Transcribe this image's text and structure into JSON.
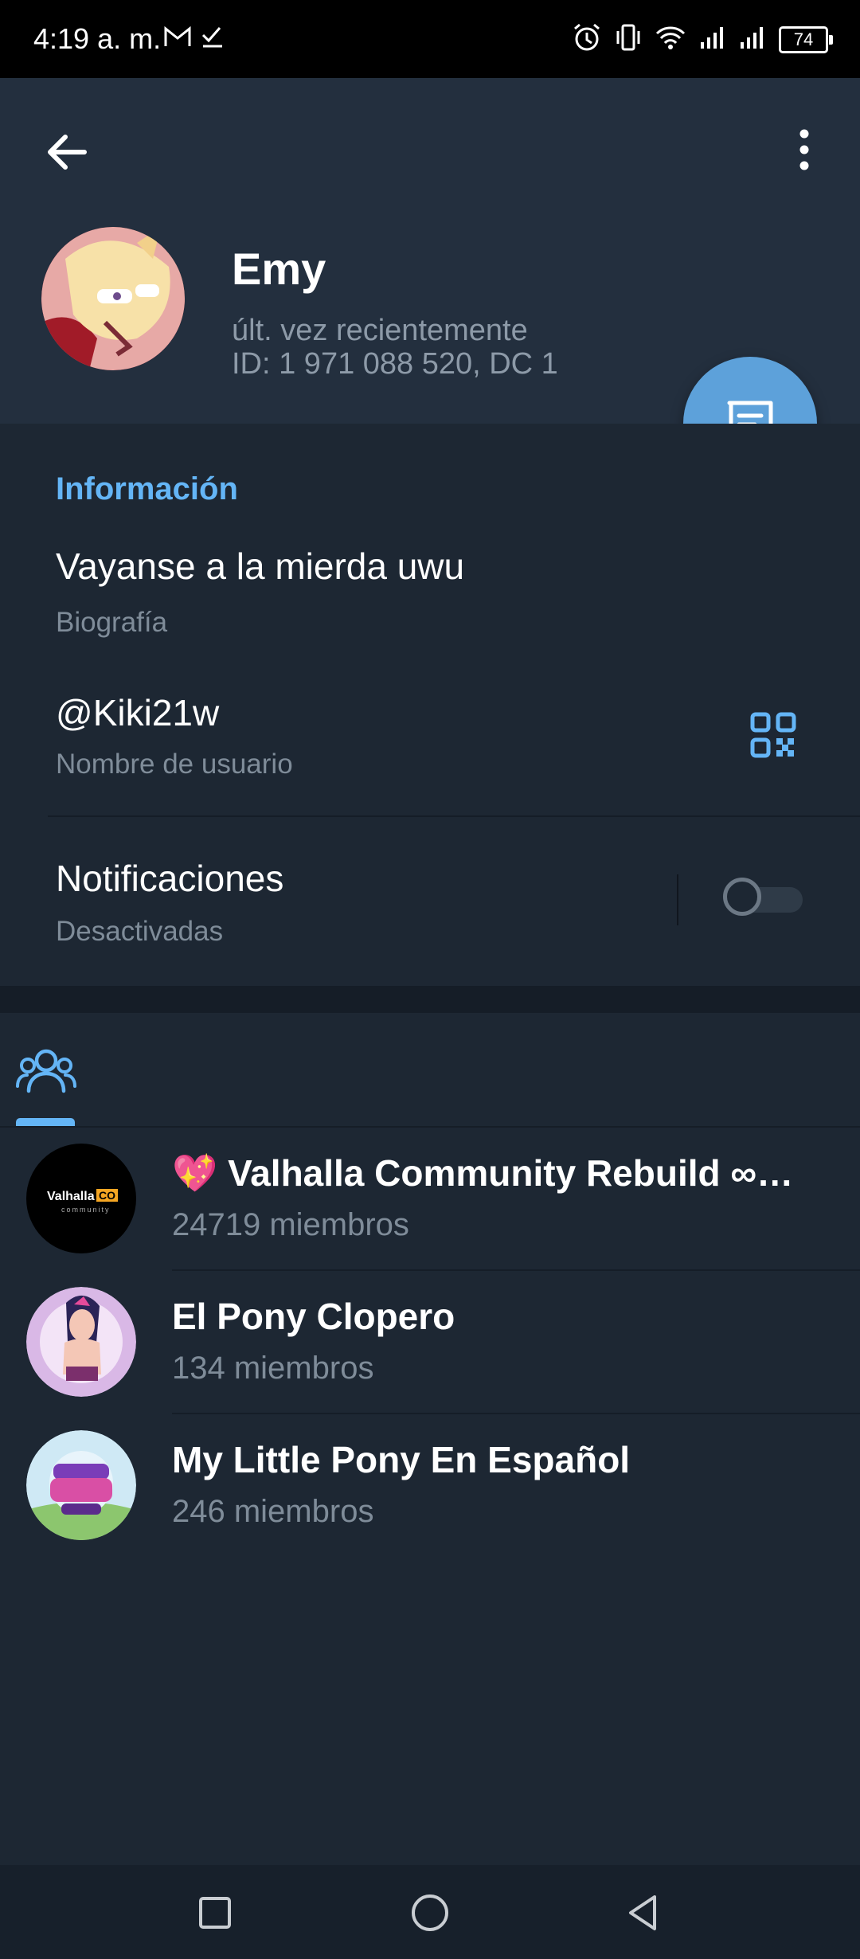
{
  "status_bar": {
    "time": "4:19 a. m.",
    "battery": "74"
  },
  "profile": {
    "name": "Emy",
    "last_seen": "últ. vez recientemente",
    "id_line": "ID: 1 971 088 520, DC 1"
  },
  "info": {
    "section_title": "Información",
    "bio_value": "Vayanse a la mierda uwu",
    "bio_label": "Biografía",
    "username_value": "@Kiki21w",
    "username_label": "Nombre de usuario",
    "notifications_label": "Notificaciones",
    "notifications_value": "Desactivadas",
    "notifications_enabled": false
  },
  "groups": [
    {
      "emoji": "💖",
      "title": "Valhalla Community Rebuild ∞…",
      "members": "24719 miembros",
      "avatar_text": "Valhalla",
      "avatar_badge": "CO",
      "avatar_small": "community"
    },
    {
      "title": "El Pony Clopero",
      "members": "134 miembros"
    },
    {
      "title": "My Little Pony En Español",
      "members": "246 miembros"
    }
  ],
  "colors": {
    "accent": "#64b5f6",
    "fab": "#5da1da",
    "background": "#1d2733",
    "header": "#232f3e"
  }
}
